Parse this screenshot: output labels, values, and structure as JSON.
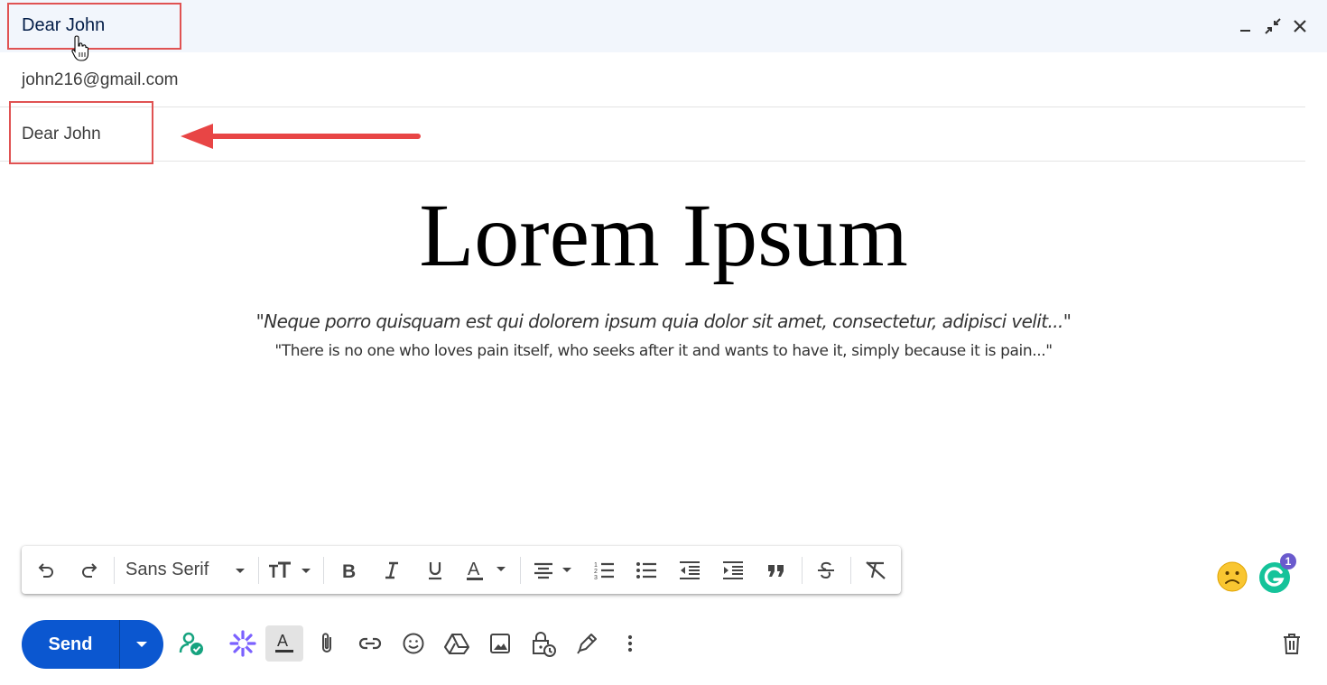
{
  "window": {
    "title": "Dear John",
    "controls": [
      "minimize-icon",
      "exit-fullscreen-icon",
      "close-icon"
    ]
  },
  "compose": {
    "recipient": "john216@gmail.com",
    "subject": "Dear John",
    "body": {
      "heading": "Lorem Ipsum",
      "quote_latin": "\"Neque porro quisquam est qui dolorem ipsum quia dolor sit amet, consectetur, adipisci velit...\"",
      "quote_english": "\"There is no one who loves pain itself, who seeks after it and wants to have it, simply because it is pain...\""
    }
  },
  "format_toolbar": {
    "font": "Sans Serif",
    "buttons": [
      "undo-icon",
      "redo-icon",
      "font-size-icon",
      "bold-icon",
      "italic-icon",
      "underline-icon",
      "text-color-icon",
      "align-icon",
      "numbered-list-icon",
      "bulleted-list-icon",
      "indent-less-icon",
      "indent-more-icon",
      "quote-icon",
      "strikethrough-icon",
      "remove-formatting-icon"
    ]
  },
  "bottom_toolbar": {
    "send_label": "Send",
    "grammarly_badge": "1",
    "buttons": [
      "user-check-icon",
      "sparkle-icon",
      "formatting-options-icon",
      "attach-icon",
      "link-icon",
      "emoji-icon",
      "drive-icon",
      "photo-icon",
      "confidential-mode-icon",
      "signature-icon",
      "more-options-icon",
      "discard-icon"
    ]
  },
  "colors": {
    "accent": "#0b57d0",
    "header_bg": "#f2f6fc",
    "highlight": "#e05252",
    "sparkle": "#7b61ff",
    "grammarly": "#15c39a"
  }
}
